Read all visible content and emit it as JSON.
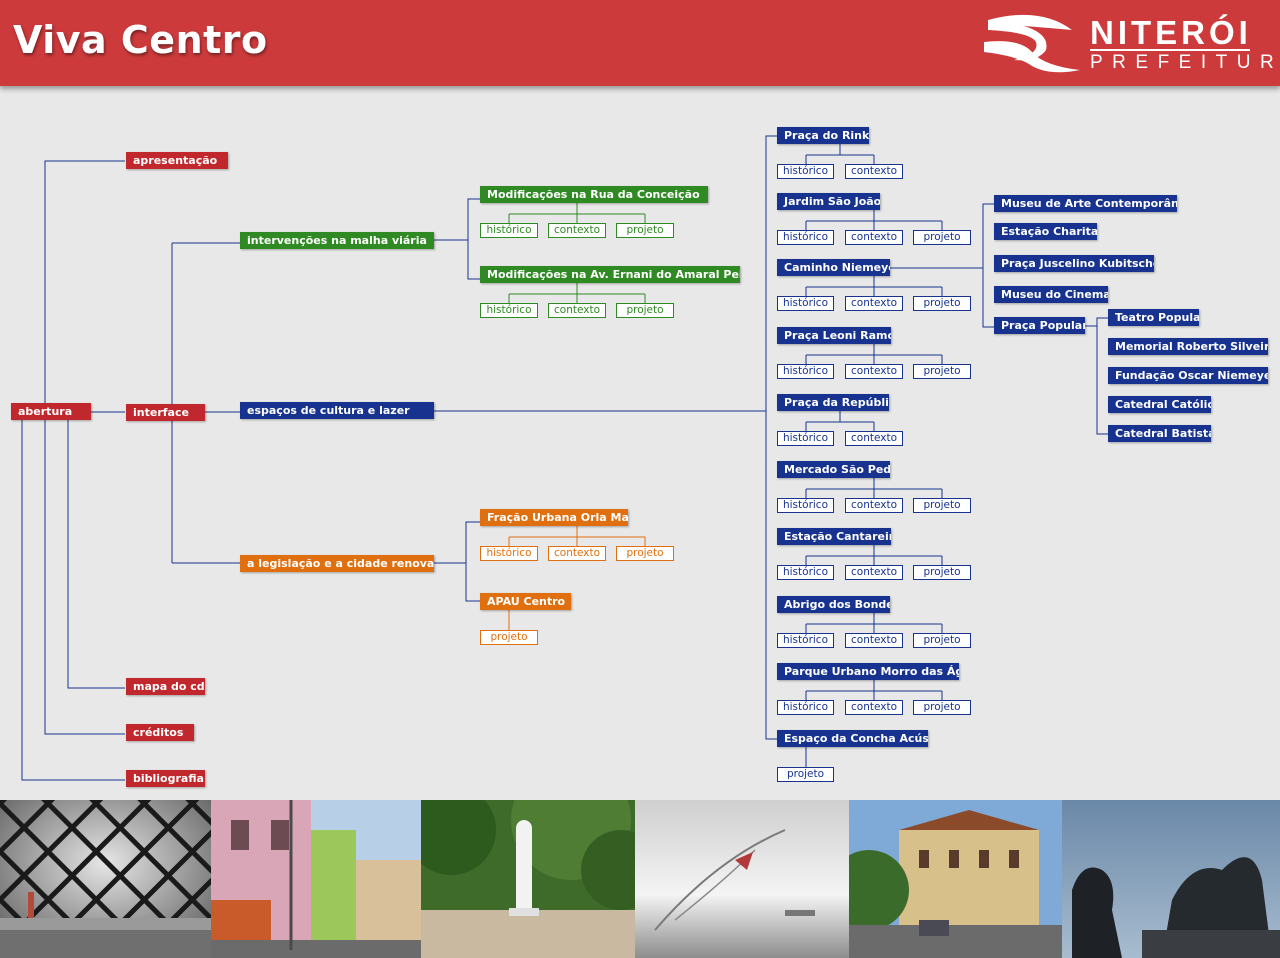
{
  "header": {
    "title": "Viva Centro",
    "logo_name": "NITERÓI",
    "logo_sub": "PREFEITURA"
  },
  "colors": {
    "header_red": "#cd3a3c",
    "node_red": "#c0282e",
    "node_green": "#2f8a23",
    "node_orange": "#e0700f",
    "node_blue": "#17338f",
    "background": "#e8e8e8"
  },
  "menu": {
    "abertura": "abertura",
    "apresentacao": "apresentação",
    "interface": "interface",
    "mapa": "mapa do cd",
    "creditos": "créditos",
    "bibliografia": "bibliografia"
  },
  "interface": {
    "malha": "intervenções na malha viária",
    "cultura": "espaços de cultura e lazer",
    "legislacao": "a legislação e a cidade renovada"
  },
  "malha_items": [
    {
      "label": "Modificações na Rua da Conceição",
      "subs": [
        "histórico",
        "contexto",
        "projeto"
      ]
    },
    {
      "label": "Modificações na Av. Ernani do Amaral Peixoto",
      "subs": [
        "histórico",
        "contexto",
        "projeto"
      ]
    }
  ],
  "legislacao_items": [
    {
      "label": "Fração Urbana Orla Mar",
      "subs": [
        "histórico",
        "contexto",
        "projeto"
      ]
    },
    {
      "label": "APAU Centro",
      "subs": [
        "projeto"
      ]
    }
  ],
  "cultura_items": [
    {
      "label": "Praça do Rink",
      "subs": [
        "histórico",
        "contexto"
      ]
    },
    {
      "label": "Jardim São João",
      "subs": [
        "histórico",
        "contexto",
        "projeto"
      ]
    },
    {
      "label": "Caminho Niemeyer",
      "subs": [
        "histórico",
        "contexto",
        "projeto"
      ]
    },
    {
      "label": "Praça Leoni Ramos",
      "subs": [
        "histórico",
        "contexto",
        "projeto"
      ]
    },
    {
      "label": "Praça da República",
      "subs": [
        "histórico",
        "contexto"
      ]
    },
    {
      "label": "Mercado São Pedro",
      "subs": [
        "histórico",
        "contexto",
        "projeto"
      ]
    },
    {
      "label": "Estação Cantareira",
      "subs": [
        "histórico",
        "contexto",
        "projeto"
      ]
    },
    {
      "label": "Abrigo dos Bondes",
      "subs": [
        "histórico",
        "contexto",
        "projeto"
      ]
    },
    {
      "label": "Parque Urbano Morro das Águas",
      "subs": [
        "histórico",
        "contexto",
        "projeto"
      ]
    },
    {
      "label": "Espaço da Concha Acústica",
      "subs": [
        "projeto"
      ]
    }
  ],
  "niemeyer_items": [
    "Museu de Arte Contemporânea",
    "Estação Charitas",
    "Praça Juscelino Kubitschek",
    "Museu do Cinema",
    "Praça Popular"
  ],
  "praca_popular_items": [
    "Teatro Popular",
    "Memorial Roberto Silveira",
    "Fundação Oscar Niemeyer",
    "Catedral Católica",
    "Catedral Batista"
  ]
}
